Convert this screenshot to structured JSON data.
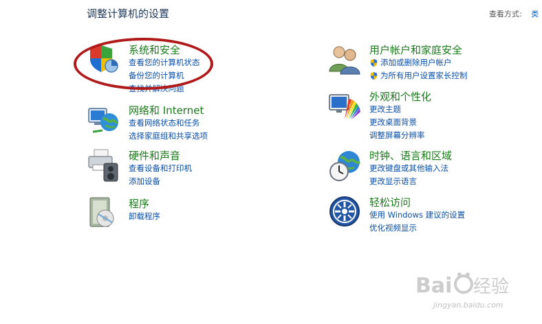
{
  "header": {
    "title": "调整计算机的设置",
    "view_by_label": "查看方式:",
    "view_by_value": "类"
  },
  "categories": [
    {
      "title": "系统和安全",
      "icon": "system-security-icon",
      "links": [
        "查看您的计算机状态",
        "备份您的计算机",
        "查找并解决问题"
      ]
    },
    {
      "title": "网络和 Internet",
      "icon": "network-globe-icon",
      "links": [
        "查看网络状态和任务",
        "选择家庭组和共享选项"
      ]
    },
    {
      "title": "硬件和声音",
      "icon": "printer-hardware-icon",
      "links": [
        "查看设备和打印机",
        "添加设备"
      ]
    },
    {
      "title": "程序",
      "icon": "programs-icon",
      "links": [
        "卸载程序"
      ]
    },
    {
      "title": "用户帐户和家庭安全",
      "icon": "user-accounts-icon",
      "links": [
        "添加或删除用户帐户",
        "为所有用户设置家长控制"
      ]
    },
    {
      "title": "外观和个性化",
      "icon": "appearance-monitor-icon",
      "links": [
        "更改主题",
        "更改桌面背景",
        "调整屏幕分辨率"
      ]
    },
    {
      "title": "时钟、语言和区域",
      "icon": "clock-globe-icon",
      "links": [
        "更改键盘或其他输入法",
        "更改显示语言"
      ]
    },
    {
      "title": "轻松访问",
      "icon": "ease-of-access-icon",
      "links": [
        "使用 Windows 建议的设置",
        "优化视频显示"
      ]
    }
  ],
  "watermark": {
    "logo_text": "Baidu经验",
    "url_text": "jingyan.baidu.com"
  }
}
